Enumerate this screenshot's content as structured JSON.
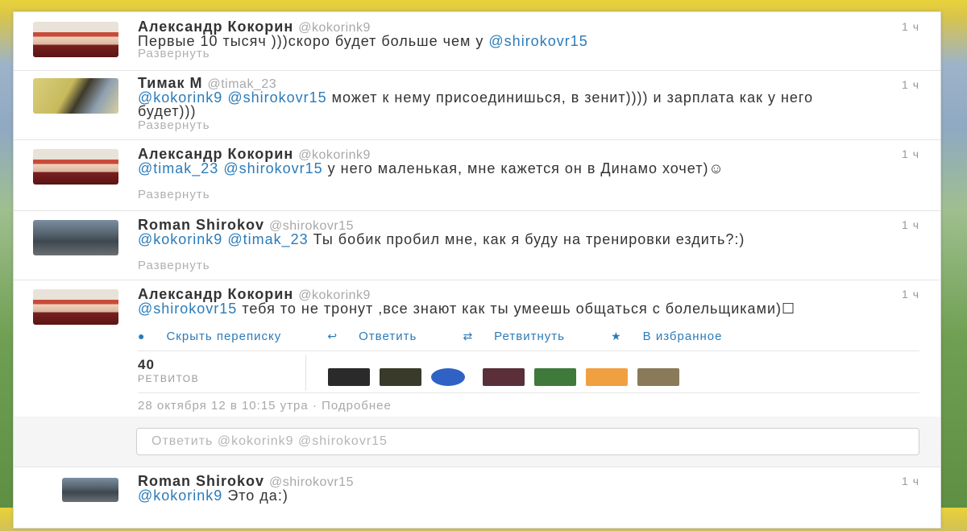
{
  "tweets": [
    {
      "name": "Александр Кокорин",
      "handle": "@kokorink9",
      "time": "1 ч",
      "text_pre": "Первые 10 тысяч )))скоро будет больше чем у ",
      "mention1": "@shirokovr15",
      "text_post": "",
      "expand": "Развернуть"
    },
    {
      "name": "Тимак М",
      "handle": "@timak_23",
      "time": "1 ч",
      "mention1": "@kokorink9",
      "mention2": "@shirokovr15",
      "text_post": " может к нему присоединишься, в зенит)))) и зарплата как у него будет)))",
      "expand": "Развернуть"
    },
    {
      "name": "Александр Кокорин",
      "handle": "@kokorink9",
      "time": "1 ч",
      "mention1": "@timak_23",
      "mention2": "@shirokovr15",
      "text_post": " у него маленькая, мне кажется он в Динамо хочет)☺",
      "expand": "Развернуть"
    },
    {
      "name": "Roman Shirokov",
      "handle": "@shirokovr15",
      "time": "1 ч",
      "mention1": "@kokorink9",
      "mention2": "@timak_23",
      "text_post": " Ты бобик пробил мне, как я буду на тренировки ездить?:)",
      "expand": "Развернуть"
    },
    {
      "name": "Александр Кокорин",
      "handle": "@kokorink9",
      "time": "1 ч",
      "mention1": "@shirokovr15",
      "text_post": " тебя то не тронут ,все знают как ты умеешь общаться с болельщиками)☐"
    }
  ],
  "expanded": {
    "actions": {
      "hide": "Скрыть переписку",
      "reply": "Ответить",
      "retweet": "Ретвитнуть",
      "favorite": "В избранное"
    },
    "retweet_count": "40",
    "retweet_label": "РЕТВИТОВ",
    "date": "28 октября 12 в 10:15 утра",
    "details": "Подробнее",
    "reply_placeholder": "Ответить @kokorink9 @shirokovr15",
    "retweeter_colors": [
      "#2a2a2a",
      "#3a3a2a",
      "#2f62c4",
      "#5a2f3a",
      "#3f7a3a",
      "#f0a040",
      "#8a7a5a"
    ]
  },
  "last_tweet": {
    "name": "Roman Shirokov",
    "handle": "@shirokovr15",
    "time": "1 ч",
    "mention1": "@kokorink9",
    "text_post": " Это да:)"
  }
}
